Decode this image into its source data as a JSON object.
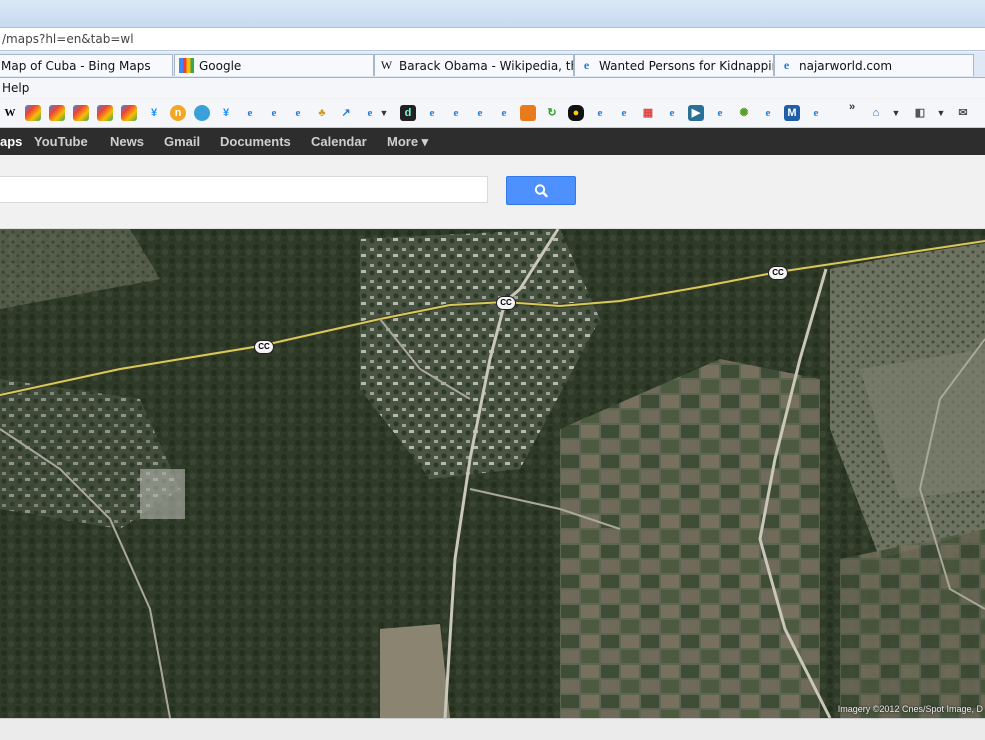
{
  "browser": {
    "address": "/maps?hl=en&tab=wl",
    "tabs": [
      {
        "label": "Map of Cuba - Bing Maps",
        "icon": "bing-icon"
      },
      {
        "label": "Google",
        "icon": "google-icon"
      },
      {
        "label": "Barack Obama - Wikipedia, th...",
        "icon": "wikipedia-icon"
      },
      {
        "label": "Wanted Persons for Kidnapping",
        "icon": "ie-icon"
      },
      {
        "label": "najarworld.com",
        "icon": "ie-icon"
      }
    ],
    "menu": {
      "help": "Help"
    }
  },
  "gbar": {
    "items": [
      "aps",
      "YouTube",
      "News",
      "Gmail",
      "Documents",
      "Calendar",
      "More ▾"
    ]
  },
  "search": {
    "button_icon": "search-icon",
    "value": ""
  },
  "map": {
    "road_labels": [
      "CC",
      "CC",
      "CC"
    ],
    "copyright": "Imagery ©2012 Cnes/Spot Image, D"
  },
  "colors": {
    "gbar_bg": "#2d2d2d",
    "search_button": "#4d90fe",
    "road": "#d8c95a"
  }
}
